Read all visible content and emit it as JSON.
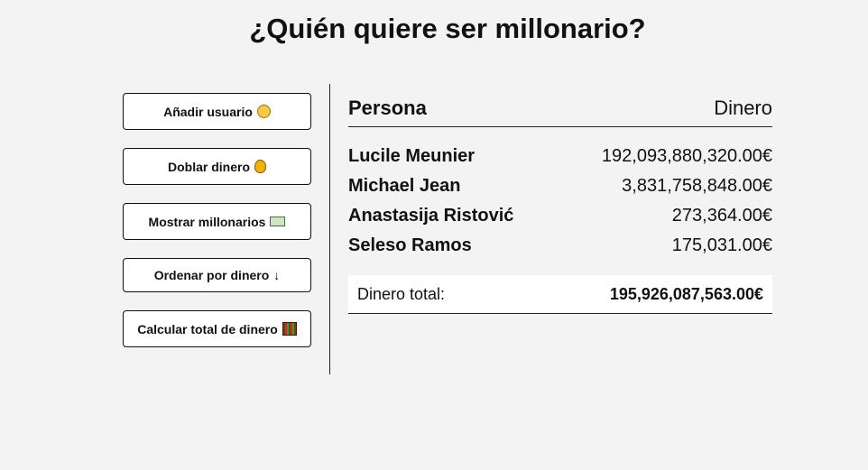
{
  "page": {
    "title": "¿Quién quiere ser millonario?"
  },
  "actions": {
    "add_user": {
      "label": "Añadir usuario",
      "icon": "face-emoji-icon"
    },
    "double_money": {
      "label": "Doblar dinero",
      "icon": "money-bag-icon"
    },
    "show_millionaires": {
      "label": "Mostrar millonarios",
      "icon": "banknote-icon"
    },
    "sort_by_money": {
      "label": "Ordenar por dinero",
      "icon_glyph": "↓"
    },
    "calculate_total": {
      "label": "Calcular total de dinero",
      "icon": "abacus-icon"
    }
  },
  "table": {
    "headers": {
      "person": "Persona",
      "money": "Dinero"
    },
    "rows": [
      {
        "name": "Lucile Meunier",
        "money": "192,093,880,320.00€"
      },
      {
        "name": "Michael Jean",
        "money": "3,831,758,848.00€"
      },
      {
        "name": "Anastasija Ristović",
        "money": "273,364.00€"
      },
      {
        "name": "Seleso Ramos",
        "money": "175,031.00€"
      }
    ],
    "total": {
      "label": "Dinero total:",
      "value": "195,926,087,563.00€"
    }
  },
  "colors": {
    "background": "#f3f3f3",
    "text": "#111111",
    "button_bg": "#ffffff"
  }
}
